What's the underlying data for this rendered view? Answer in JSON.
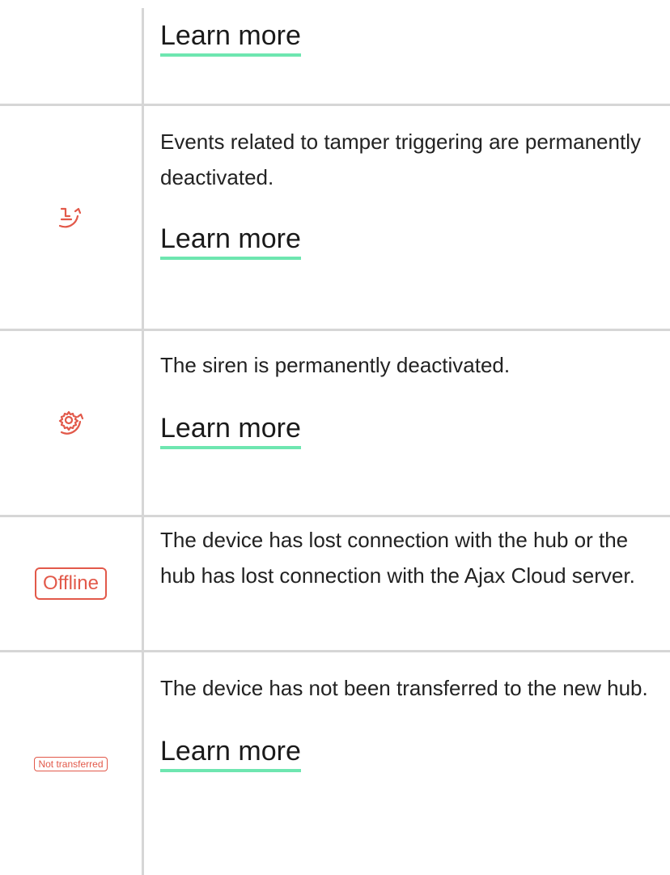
{
  "rows": [
    {
      "learn_more": "Learn more"
    },
    {
      "icon": "tamper-deactivated-icon",
      "description": "Events related to tamper triggering are permanently deactivated.",
      "learn_more": "Learn more"
    },
    {
      "icon": "siren-deactivated-icon",
      "description": "The siren is permanently deactivated.",
      "learn_more": "Learn more"
    },
    {
      "badge": "Offline",
      "description": "The device has lost connection with the hub or the hub has lost connection with the Ajax Cloud server."
    },
    {
      "badge": "Not transferred",
      "description": "The device has not been transferred to the new hub.",
      "learn_more": "Learn more"
    }
  ],
  "colors": {
    "accent_red": "#e2594a",
    "underline_green": "#6ee6b0",
    "grid": "#d6d6d6"
  }
}
